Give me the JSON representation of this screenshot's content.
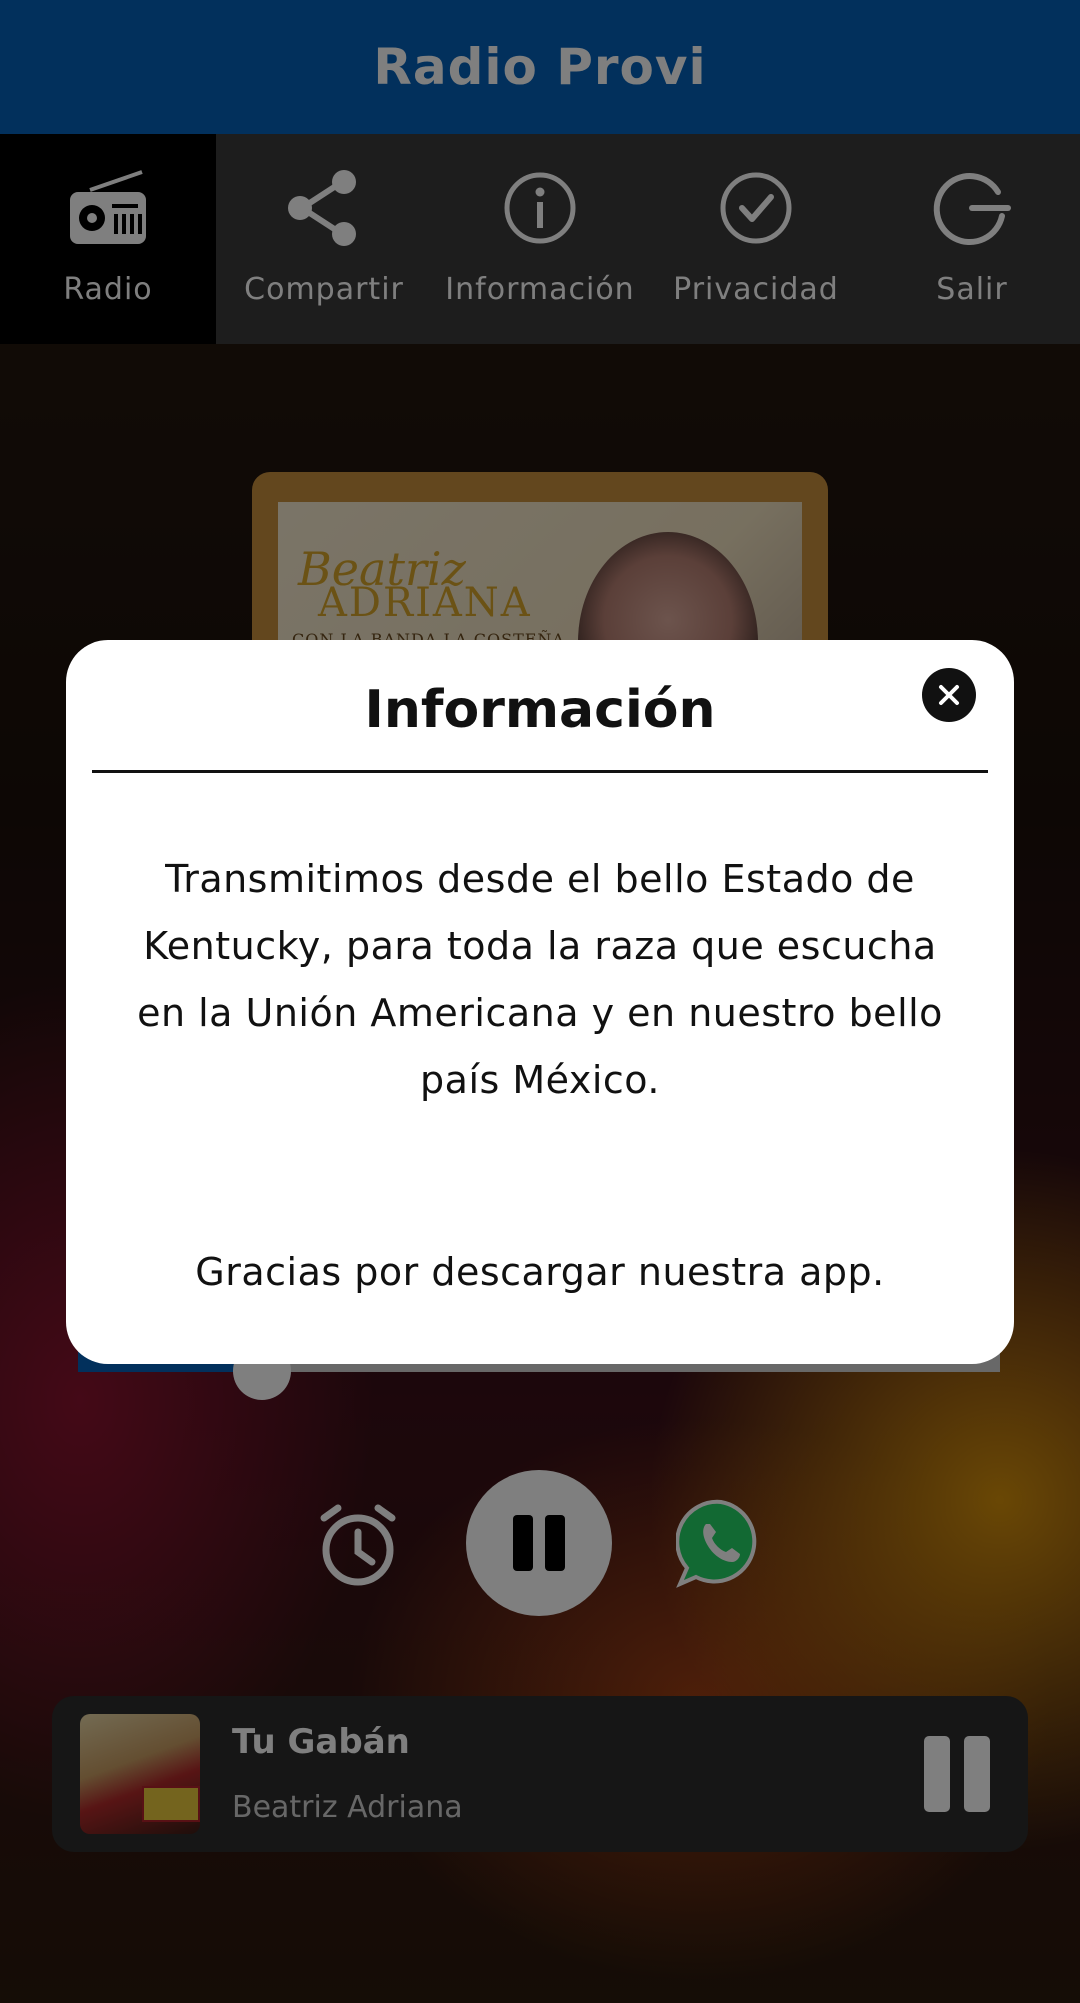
{
  "header": {
    "title": "Radio Provi"
  },
  "tabs": [
    {
      "label": "Radio",
      "icon": "radio-icon",
      "active": true
    },
    {
      "label": "Compartir",
      "icon": "share-icon",
      "active": false
    },
    {
      "label": "Información",
      "icon": "info-icon",
      "active": false
    },
    {
      "label": "Privacidad",
      "icon": "check-circle-icon",
      "active": false
    },
    {
      "label": "Salir",
      "icon": "power-icon",
      "active": false
    }
  ],
  "album": {
    "artist_script": "Beatriz",
    "artist_caps": "ADRIANA",
    "subtitle": "CON LA BANDA LA COSTEÑA"
  },
  "progress": {
    "fraction": 0.2
  },
  "mini_player": {
    "title": "Tu Gabán",
    "artist": "Beatriz Adriana"
  },
  "dialog": {
    "title": "Información",
    "body": "Transmitimos desde el bello Estado de Kentucky, para toda la raza que escucha en la Unión Americana y en nuestro bello país México.",
    "thanks": "Gracias por descargar nuestra app."
  },
  "colors": {
    "header": "#0561b8",
    "tabbar": "#3a3a3a",
    "active_tab": "#000000",
    "whatsapp": "#25d366"
  }
}
